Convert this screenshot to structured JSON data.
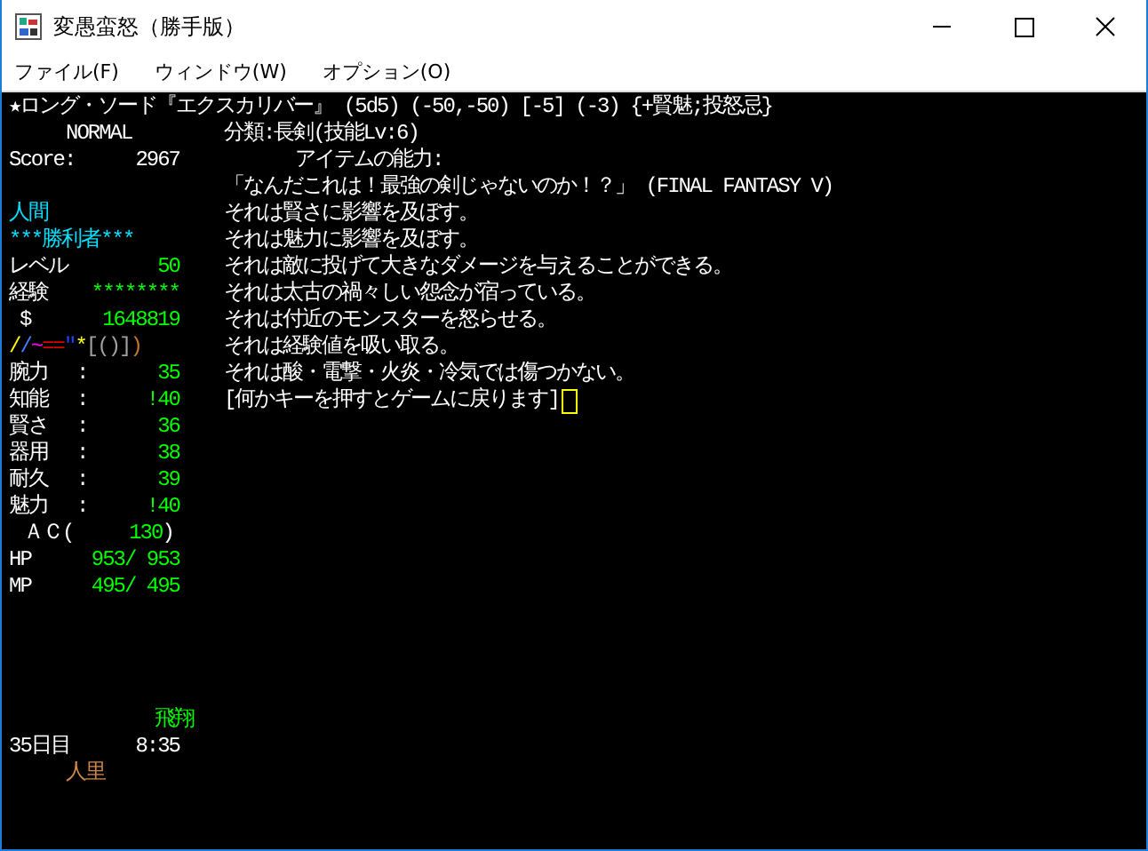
{
  "window": {
    "title": "変愚蛮怒（勝手版）",
    "menu": [
      "ファイル(F)",
      "ウィンドウ(W)",
      "オプション(O)"
    ]
  },
  "terminal": {
    "item_line": "★ロング・ソード『エクスカリバー』 (5d5) (-50,-50) [-5] (-3) {+賢魅;投怒忌}",
    "mode": "NORMAL",
    "score_label": "Score:",
    "score": "2967",
    "race": "人間",
    "rank": "***勝利者***",
    "level": {
      "label": "レベル",
      "value": "50"
    },
    "exp": {
      "label": "経験",
      "value": "********"
    },
    "gold": {
      "label": "$",
      "value": "1648819"
    },
    "equipment": [
      {
        "text": "/",
        "color": "#ffff00"
      },
      {
        "text": "/",
        "color": "#4080ff"
      },
      {
        "text": "~",
        "color": "#ff00ff"
      },
      {
        "text": "==",
        "color": "#e00000"
      },
      {
        "text": "\"",
        "color": "#2040ff"
      },
      {
        "text": "*",
        "color": "#ffff00"
      },
      {
        "text": "[()]",
        "color": "#a0a0a0"
      },
      {
        "text": ")",
        "color": "#c07830"
      }
    ],
    "stats": [
      {
        "label": "腕力",
        "colon": ":",
        "value": "35"
      },
      {
        "label": "知能",
        "colon": ":",
        "value": "!40"
      },
      {
        "label": "賢さ",
        "colon": ":",
        "value": "36"
      },
      {
        "label": "器用",
        "colon": ":",
        "value": "38"
      },
      {
        "label": "耐久",
        "colon": ":",
        "value": "39"
      },
      {
        "label": "魅力",
        "colon": ":",
        "value": "!40"
      }
    ],
    "ac": {
      "open": "ＡＣ(",
      "value": "130",
      "close": ")"
    },
    "hp": {
      "label": "HP",
      "value": "953/ 953"
    },
    "mp": {
      "label": "MP",
      "value": "495/ 495"
    },
    "flight": "飛翔",
    "day": "35日目",
    "time": "8:35",
    "location": "人里",
    "lines": [
      {
        "text": "分類:長剣(技能Lv:6)",
        "kind": "plain"
      },
      {
        "text": "アイテムの能力:",
        "kind": "heading"
      },
      {
        "text": "「なんだこれは！最強の剣じゃないのか！？」 (FINAL FANTASY V)",
        "kind": "plain"
      },
      {
        "text": "それは賢さに影響を及ぼす。",
        "kind": "plain"
      },
      {
        "text": "それは魅力に影響を及ぼす。",
        "kind": "plain"
      },
      {
        "text": "それは敵に投げて大きなダメージを与えることができる。",
        "kind": "plain"
      },
      {
        "text": "それは太古の禍々しい怨念が宿っている。",
        "kind": "plain"
      },
      {
        "text": "それは付近のモンスターを怒らせる。",
        "kind": "plain"
      },
      {
        "text": "それは経験値を吸い取る。",
        "kind": "plain"
      },
      {
        "text": "それは酸・電撃・火炎・冷気では傷つかない。",
        "kind": "plain"
      },
      {
        "text": "[何かキーを押すとゲームに戻ります]",
        "kind": "prompt"
      }
    ]
  }
}
